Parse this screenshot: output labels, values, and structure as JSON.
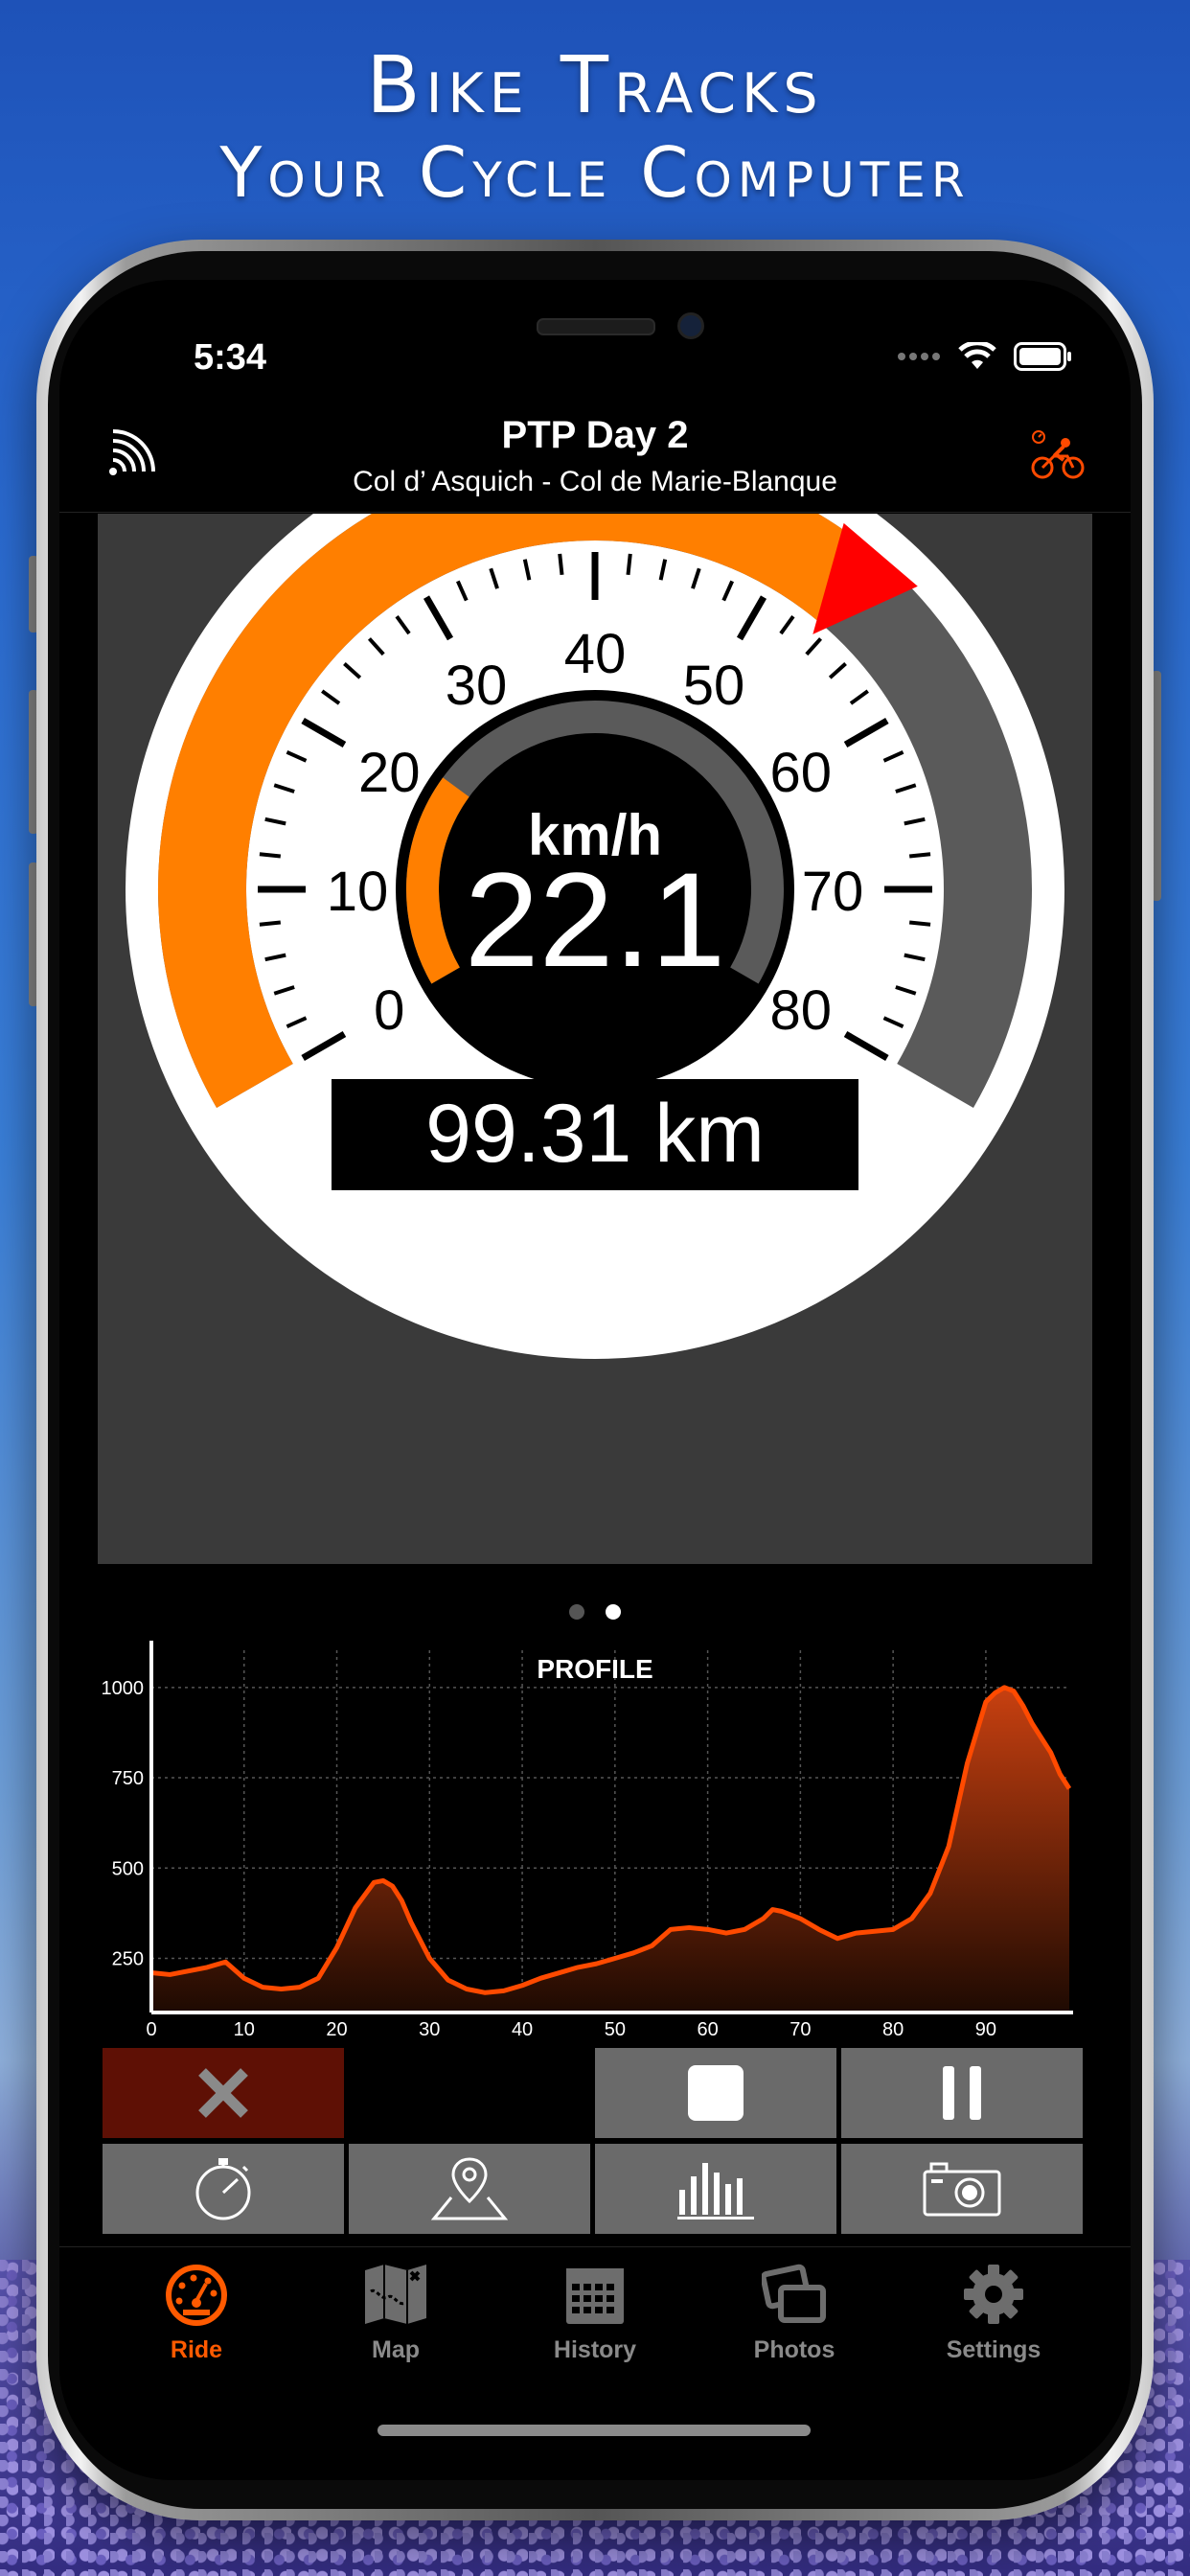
{
  "promo": {
    "title": "Bike Tracks",
    "subtitle": "Your Cycle Computer"
  },
  "status_bar": {
    "time": "5:34",
    "icons": [
      "signal-dots-icon",
      "wifi-icon",
      "battery-icon"
    ]
  },
  "nav": {
    "title": "PTP Day 2",
    "subtitle": "Col d’ Asquich - Col de Marie-Blanque",
    "left_icon": "sensor-signal-icon",
    "right_icon": "cyclist-bike-icon"
  },
  "speedometer": {
    "unit": "km/h",
    "speed": "22.1",
    "speed_value": 22.1,
    "distance": "99.31 km",
    "scale_labels": [
      "0",
      "10",
      "20",
      "30",
      "40",
      "50",
      "60",
      "70",
      "80"
    ],
    "scale_max": 80,
    "colors": {
      "arc_fill": "#ff7f00",
      "arc_track": "#5a5a5a",
      "max_marker": "#ff0000"
    }
  },
  "pager": {
    "pages": 2,
    "active": 2
  },
  "profile": {
    "title": "PROFILE",
    "x_ticks": [
      "0",
      "10",
      "20",
      "30",
      "40",
      "50",
      "60",
      "70",
      "80",
      "90"
    ],
    "y_ticks": [
      "250",
      "500",
      "750",
      "1000"
    ]
  },
  "chart_data": {
    "type": "area",
    "title": "PROFILE",
    "xlim": [
      0,
      99
    ],
    "ylim": [
      100,
      1050
    ],
    "grid": true,
    "x": [
      0,
      2,
      4,
      6,
      8,
      10,
      12,
      14,
      16,
      18,
      20,
      22,
      24,
      25,
      26,
      27,
      28,
      30,
      32,
      34,
      36,
      38,
      40,
      42,
      44,
      46,
      48,
      50,
      52,
      54,
      56,
      58,
      60,
      62,
      64,
      66,
      67,
      68,
      70,
      72,
      74,
      76,
      78,
      80,
      82,
      84,
      86,
      88,
      90,
      91,
      92,
      93,
      94,
      95,
      96,
      97,
      98,
      99
    ],
    "y": [
      210,
      205,
      215,
      225,
      240,
      195,
      170,
      165,
      170,
      195,
      280,
      390,
      460,
      465,
      450,
      410,
      350,
      250,
      190,
      165,
      155,
      160,
      175,
      195,
      210,
      225,
      235,
      250,
      265,
      285,
      330,
      335,
      330,
      320,
      330,
      360,
      385,
      380,
      360,
      330,
      305,
      320,
      325,
      330,
      360,
      430,
      560,
      790,
      960,
      985,
      1000,
      990,
      950,
      900,
      860,
      820,
      760,
      720
    ],
    "colors": {
      "line": "#ff4a00",
      "fill_top": "#c84010",
      "fill_bottom": "#1e0a02"
    }
  },
  "controls": {
    "row1": [
      {
        "name": "discard-button",
        "icon": "x-icon",
        "color": "#5e1005"
      },
      {
        "name": "stop-button",
        "icon": "stop-square-icon"
      },
      {
        "name": "pause-button",
        "icon": "pause-icon"
      }
    ],
    "row2": [
      {
        "name": "timer-button",
        "icon": "stopwatch-icon"
      },
      {
        "name": "location-button",
        "icon": "map-pin-icon"
      },
      {
        "name": "stats-button",
        "icon": "bar-graph-icon"
      },
      {
        "name": "camera-button",
        "icon": "camera-icon"
      }
    ]
  },
  "tabs": [
    {
      "label": "Ride",
      "icon": "speedometer-icon",
      "active": true
    },
    {
      "label": "Map",
      "icon": "folded-map-icon",
      "active": false
    },
    {
      "label": "History",
      "icon": "calendar-icon",
      "active": false
    },
    {
      "label": "Photos",
      "icon": "photos-icon",
      "active": false
    },
    {
      "label": "Settings",
      "icon": "gear-icon",
      "active": false
    }
  ],
  "colors": {
    "accent": "#ff5a00",
    "tab_inactive": "#8a8a8a"
  }
}
